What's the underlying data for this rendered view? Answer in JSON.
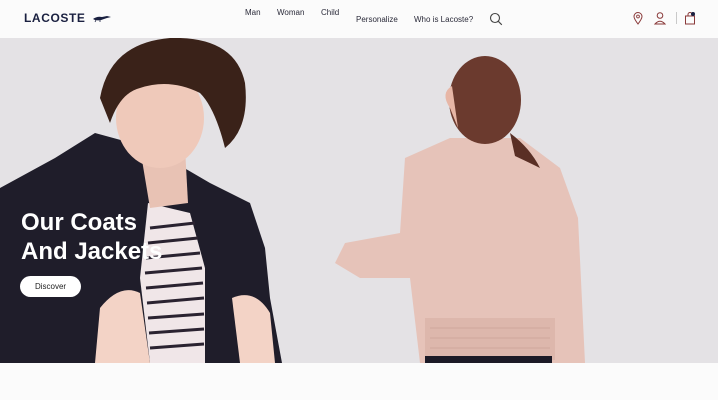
{
  "brand": {
    "name": "LACOSTE",
    "logo_icon": "crocodile-icon",
    "accent": "#1a2040"
  },
  "nav": {
    "items": [
      {
        "label": "Man"
      },
      {
        "label": "Woman"
      },
      {
        "label": "Child"
      },
      {
        "label": "Personalize"
      },
      {
        "label": "Who is Lacoste?"
      }
    ],
    "search_icon": "search-icon"
  },
  "utility": {
    "icons": [
      "location-pin-icon",
      "account-icon",
      "cart-icon"
    ]
  },
  "hero": {
    "title": "Our Coats\nAnd Jackets",
    "cta_label": "Discover",
    "background": "#e4e2e5"
  }
}
